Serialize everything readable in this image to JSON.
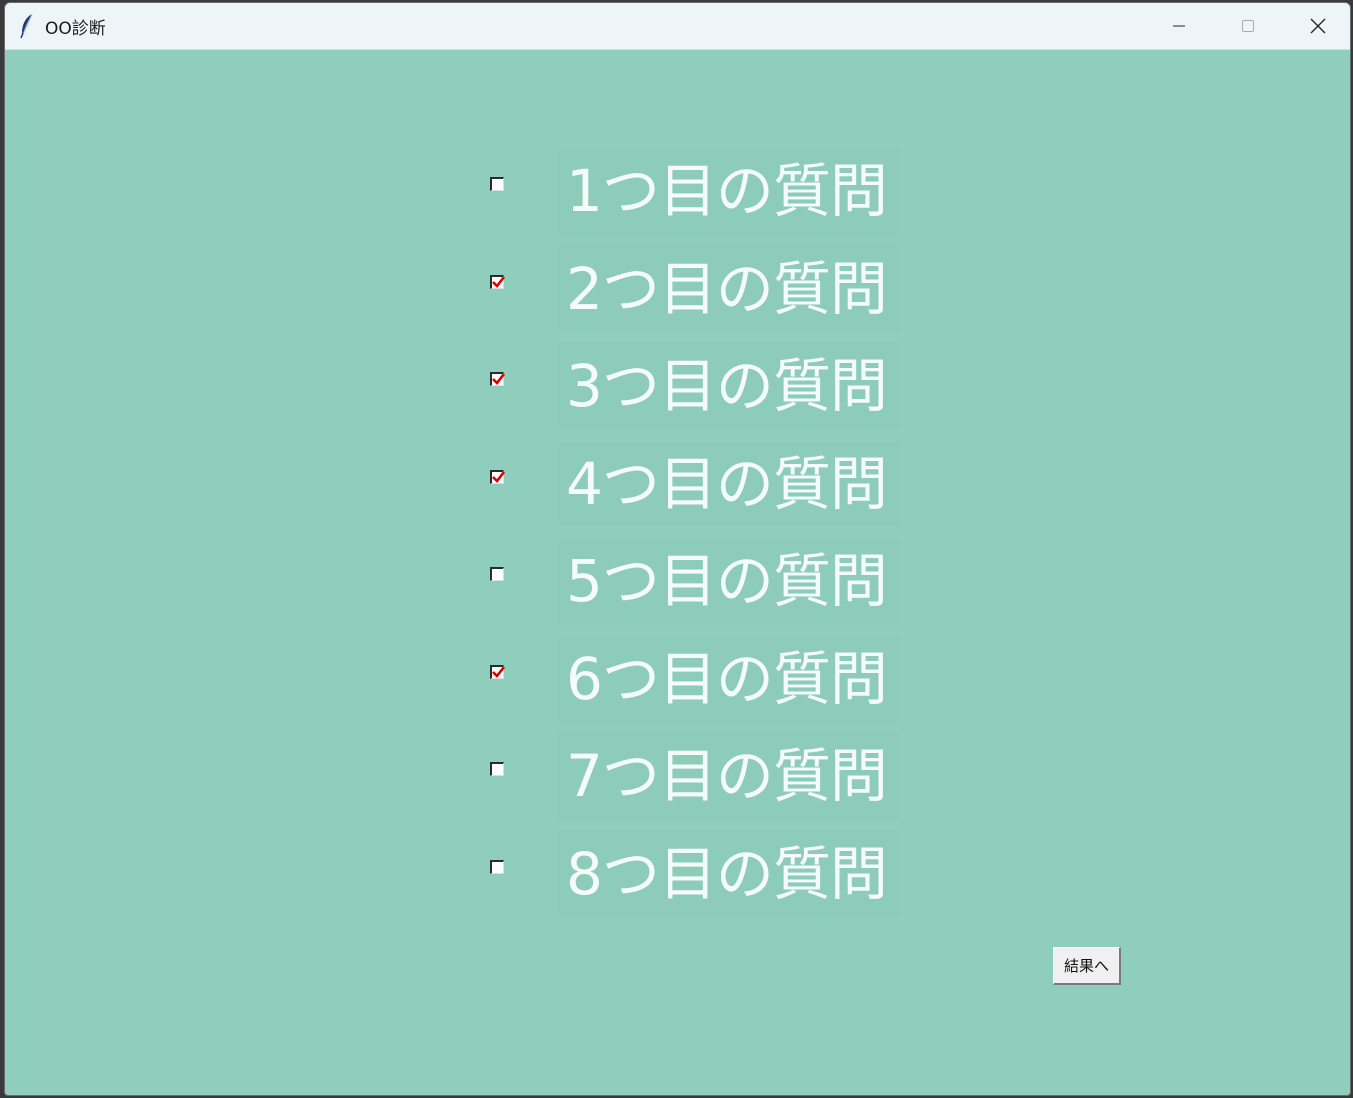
{
  "window": {
    "title": "OO診断",
    "controls": {
      "minimize_icon": "minimize-icon",
      "maximize_icon": "maximize-icon",
      "close_icon": "close-icon"
    }
  },
  "colors": {
    "background": "#8fcdbc",
    "label_text": "#f4fbf8",
    "check_mark": "#e00000",
    "titlebar": "#eef5f9"
  },
  "questions": [
    {
      "label": "1つ目の質問",
      "checked": false
    },
    {
      "label": "2つ目の質問",
      "checked": true
    },
    {
      "label": "3つ目の質問",
      "checked": true
    },
    {
      "label": "4つ目の質問",
      "checked": true
    },
    {
      "label": "5つ目の質問",
      "checked": false
    },
    {
      "label": "6つ目の質問",
      "checked": true
    },
    {
      "label": "7つ目の質問",
      "checked": false
    },
    {
      "label": "8つ目の質問",
      "checked": false
    }
  ],
  "result_button": {
    "label": "結果へ"
  }
}
